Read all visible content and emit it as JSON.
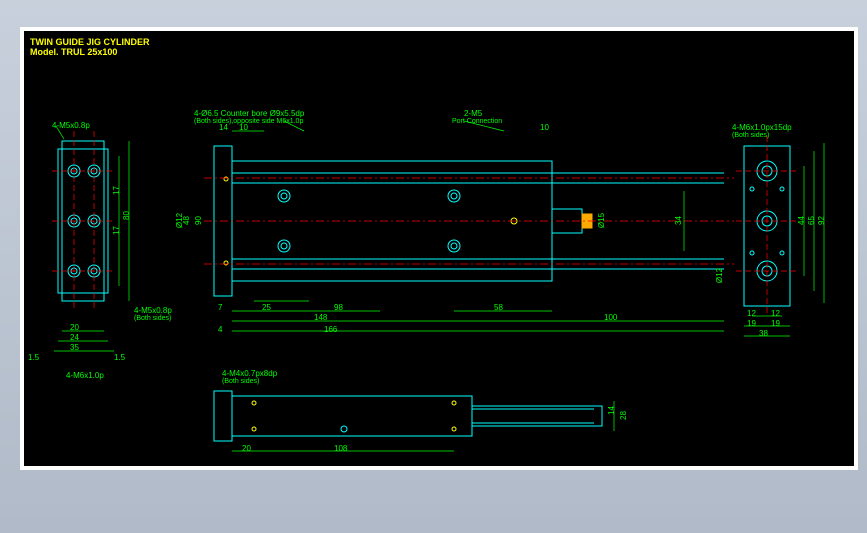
{
  "title": {
    "l1": "TWIN GUIDE JIG CYLINDER",
    "l2": "Model. TRUL 25x100"
  },
  "dims": {
    "d1": "4-M5x0.8p",
    "d2": "4-M5x0.8p",
    "d3": "4-M6x1.0p",
    "d4": "4-Ø6.5 Counter bore Ø9x5.5dp",
    "d5": "(Both sides),opposite side M6x1.0p",
    "d6": "2-M5",
    "d7": "Port Connection",
    "d8": "4-M6x1.0px15dp",
    "d9": "(Both sides)",
    "d10": "4-M4x0.7px8dp",
    "d11": "(Both sides)",
    "d12": "(Both sides)",
    "v20": "20",
    "v24": "24",
    "v35": "35",
    "v15a": "1.5",
    "v15b": "1.5",
    "v17": "17",
    "v17b": "17",
    "v80": "80",
    "v90": "90",
    "v48": "48",
    "v12a": "Ø12",
    "v14": "14",
    "v10": "10",
    "v10b": "10",
    "v7": "7",
    "v4": "4",
    "v25": "25",
    "v98": "98",
    "v148": "148",
    "v166": "166",
    "v58": "58",
    "v100": "100",
    "v15c": "Ø15",
    "v34": "34",
    "v12b": "Ø12",
    "v12c": "12",
    "v12d": "12",
    "v19": "19",
    "v19b": "19",
    "v38": "38",
    "v44": "44",
    "v65": "65",
    "v92": "92",
    "v20b": "20",
    "v108": "108",
    "v14b": "14",
    "v28": "28"
  }
}
